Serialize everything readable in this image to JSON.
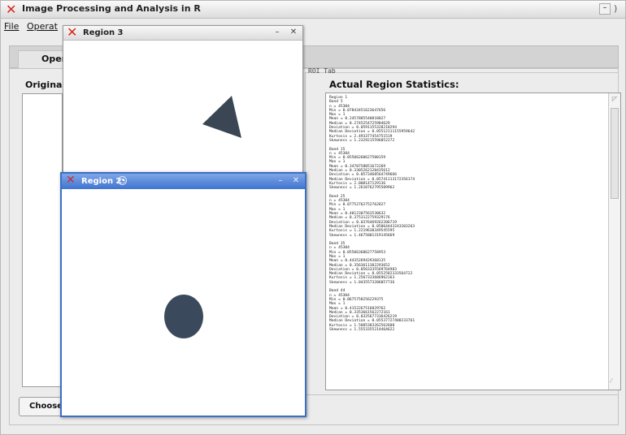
{
  "app": {
    "title": "Image Processing and Analysis in R"
  },
  "menu": {
    "file": "File",
    "operations": "Operat"
  },
  "tabs": {
    "operations": "Operatic"
  },
  "original_panel": {
    "label": "Original im"
  },
  "choose_button": {
    "label": "Choose I"
  },
  "roi": {
    "tab_label": "ROI Tab",
    "stats_title": "Actual Region Statistics:",
    "stats_text": "Region 1\nBand 5\nn = 45304\nMin = 0.07843451623647656\nMax = 1\nMean = 0.2457885540818027\nMedian = 0.2745254725984629\nDeviation = 0.0591155328218294\nMedian Deviation = 0.05512111155959642\nKurtosis = 2.493377454751519\nSkewness = 1.2329215596052272\n\nBand 15\nn = 45304\nMin = 0.05506260627500159\nMax = 1\nMean = 0.3470758051672269\nMedian = 0.3305262120435612\nDeviation = 0.0573468564749666\nMedian Deviation = 0.05741113172356174\nKurtosis = 2.008147129136\nSkewness = 1.2610762795509962\n\nBand 25\nn = 45304\nMin = 0.07752762752762827\nMax = 1\nMean = 0.4012307563530632\nMedian = 0.3753122759329176\nDeviation = 0.0376469262206719\nMedian Deviation = 0.05064443243203263\nKurtosis = 1.2219630349545595\nSkewness = 1.4675001319145669\n\nBand 35\nn = 45304\nMin = 0.05506368627758953\nMax = 1\nMean = 0.4435269429368135\nMedian = 0.3563611382293652\nDeviation = 0.0563335569764983\nMedian Deviation = 0.0552582333564722\nKurtosis = 1.2567333686962163\nSkewness = 1.0435573206057736\n\nBand 44\nn = 45304\nMin = 0.0675758256229375\nMax = 1\nMean = 0.4152267516829762\nMedian = 0.3353661562272161\nDeviation = 0.0325677336426219\nMedian Deviation = 0.05537727408233761\nKurtosis = 1.5885383262562608\nSkewness = 1.5553355214464622"
  },
  "region3": {
    "title": "Region 3",
    "shape": "triangle",
    "fill_color": "#3a4653"
  },
  "region2": {
    "title": "Region 2",
    "shape": "ellipse",
    "fill_color": "#3a4a5c"
  },
  "colors": {
    "accent": "#3b6fc6",
    "app_icon": "#d7261e",
    "background": "#ececec"
  }
}
